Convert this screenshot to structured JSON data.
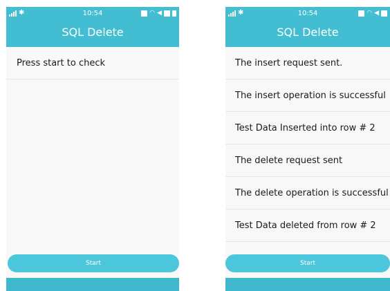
{
  "left_screen": {
    "status": {
      "time": "10:54"
    },
    "title": "SQL Delete",
    "rows": [
      "Press start to check"
    ],
    "start_label": "Start"
  },
  "right_screen": {
    "status": {
      "time": "10:54"
    },
    "title": "SQL Delete",
    "rows": [
      "The insert request sent.",
      "The insert operation is successful",
      "Test Data Inserted into row # 2",
      "The delete request sent",
      "The delete operation is successful",
      "Test Data deleted from row # 2"
    ],
    "start_label": "Start"
  },
  "icons": {
    "signal": "signal-icon",
    "bluetooth": "bluetooth-icon",
    "wifi": "wifi-icon",
    "battery": "battery-icon"
  },
  "colors": {
    "header": "#42bdd2",
    "button": "#4cc6db",
    "bottom_bar": "#3fb7cc"
  }
}
